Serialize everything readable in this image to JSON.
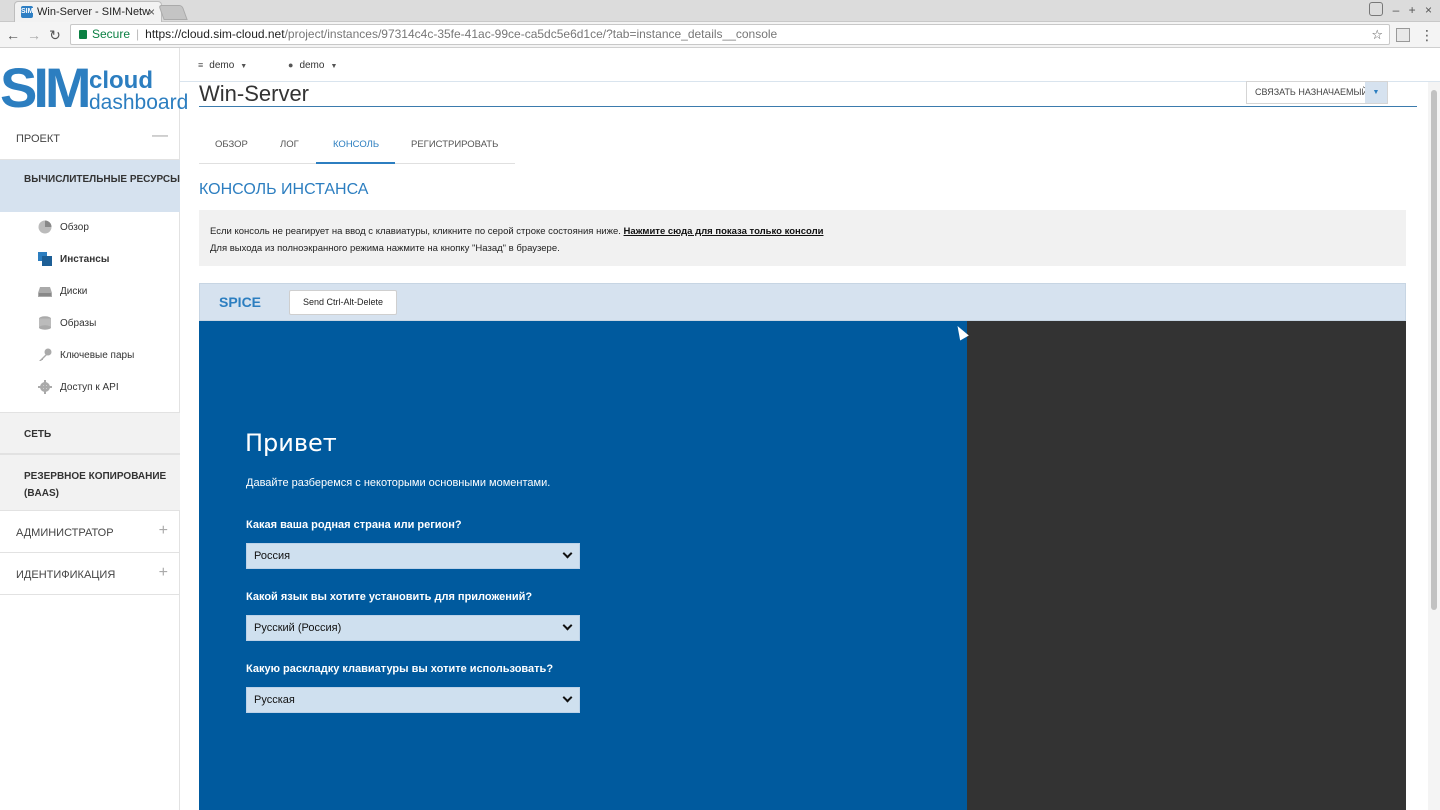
{
  "browser": {
    "tab_title": "Win-Server - SIM-Netw",
    "tab_favicon": "SIM",
    "address": {
      "secure_label": "Secure",
      "host": "https://cloud.sim-cloud.net",
      "path": "/project/instances/97314c4c-35fe-41ac-99ce-ca5dc5e6d1ce/?tab=instance_details__console"
    }
  },
  "logo": {
    "mark": "SIM",
    "line1": "cloud",
    "line2": "dashboard"
  },
  "sidebar": {
    "project": "ПРОЕКТ",
    "compute": "ВЫЧИСЛИТЕЛЬНЫЕ РЕСУРСЫ",
    "items": [
      {
        "label": "Обзор",
        "icon": "pie-chart-icon"
      },
      {
        "label": "Инстансы",
        "icon": "instances-icon"
      },
      {
        "label": "Диски",
        "icon": "disk-icon"
      },
      {
        "label": "Образы",
        "icon": "database-icon"
      },
      {
        "label": "Ключевые пары",
        "icon": "key-icon"
      },
      {
        "label": "Доступ к API",
        "icon": "gear-icon"
      }
    ],
    "network": "СЕТЬ",
    "backup": "РЕЗЕРВНОЕ КОПИРОВАНИЕ (BAAS)",
    "admin": "АДМИНИСТРАТОР",
    "identity": "ИДЕНТИФИКАЦИЯ"
  },
  "topbar": {
    "project": "demo",
    "user": "demo"
  },
  "page": {
    "title": "Win-Server",
    "associate_ip": "СВЯЗАТЬ НАЗНАЧАЕМЫЙ IP",
    "tabs": [
      "ОБЗОР",
      "ЛОГ",
      "КОНСОЛЬ",
      "РЕГИСТРИРОВАТЬ"
    ],
    "active_tab": "КОНСОЛЬ",
    "section_title": "КОНСОЛЬ ИНСТАНСА",
    "info_line1": "Если консоль не реагирует на ввод с клавиатуры, кликните по серой строке состояния ниже.",
    "info_link": "Нажмите сюда для показа только консоли",
    "info_line2": "Для выхода из полноэкранного режима нажмите на кнопку \"Назад\" в браузере.",
    "spice_label": "SPICE",
    "cad_button": "Send Ctrl-Alt-Delete"
  },
  "console": {
    "greeting": "Привет",
    "subtitle": "Давайте разберемся с некоторыми основными моментами.",
    "q1": "Какая ваша родная страна или регион?",
    "a1": "Россия",
    "q2": "Какой язык вы хотите установить для приложений?",
    "a2": "Русский (Россия)",
    "q3": "Какую раскладку клавиатуры вы хотите использовать?",
    "a3": "Русская"
  },
  "colors": {
    "accent": "#2c7ec0",
    "console_bg": "#005a9e",
    "active_bg": "#d6e2ef"
  }
}
